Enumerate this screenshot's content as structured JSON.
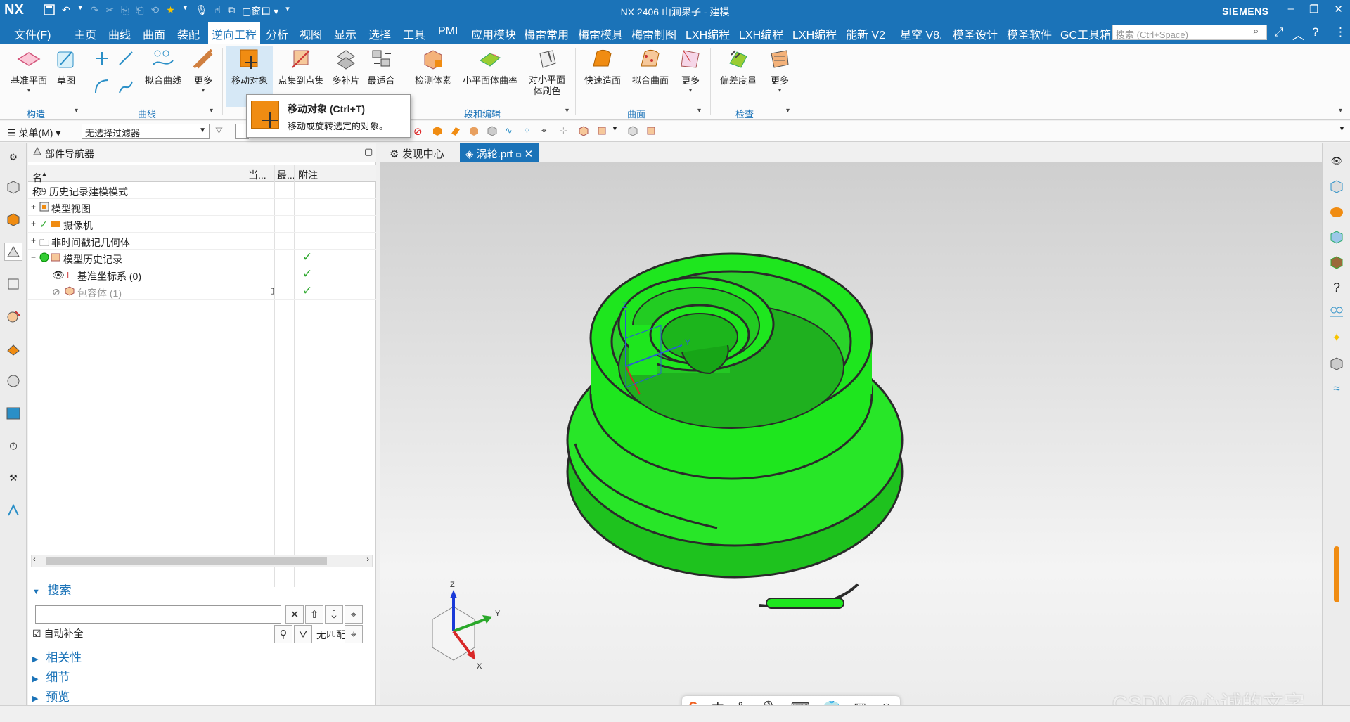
{
  "titlebar": {
    "logo": "NX",
    "title": "NX 2406 山涧果子 - 建模",
    "brand": "SIEMENS",
    "window_menu": "窗口",
    "qa_icons": [
      "save-icon",
      "undo-icon",
      "redo-icon",
      "star-icon",
      "mic-icon"
    ]
  },
  "menubar": {
    "file": "文件(F)",
    "tabs": [
      "主页",
      "曲线",
      "曲面",
      "装配",
      "逆向工程",
      "分析",
      "视图",
      "显示",
      "选择",
      "工具",
      "PMI",
      "应用模块",
      "梅雷常用",
      "梅雷模具",
      "梅雷制图",
      "LXH编程",
      "LXH编程",
      "LXH编程",
      "能新 V2",
      "星空 V8.",
      "模圣设计",
      "模圣软件",
      "GC工具箱"
    ],
    "active_tab": "逆向工程",
    "search_placeholder": "搜索 (Ctrl+Space)"
  },
  "ribbon": {
    "buttons": {
      "datum_plane": "基准平面",
      "sketch": "草图",
      "fit_curve": "拟合曲线",
      "more1": "更多",
      "move_object": "移动对象",
      "points_to_pointset": "点集到点集",
      "multi_patch": "多补片",
      "best_fit": "最适合",
      "check_body": "检测体素",
      "small_plane_curvature": "小平面体曲率",
      "small_plane_brush": "对小平面体刷色",
      "quick_surface": "快速造面",
      "fit_surface": "拟合曲面",
      "more2": "更多",
      "deviation_measure": "偏差度量",
      "more3": "更多"
    },
    "groups": {
      "construct": "构造",
      "curve": "曲线",
      "segment_edit": "段和编辑",
      "surface": "曲面",
      "check": "检查"
    }
  },
  "tooltip": {
    "title": "移动对象 (Ctrl+T)",
    "desc": "移动或旋转选定的对象。"
  },
  "selbar": {
    "menu": "菜单(M)",
    "filter": "无选择过滤器"
  },
  "navigator": {
    "title": "部件导航器",
    "columns": {
      "name": "名称",
      "current": "当...",
      "latest": "最...",
      "note": "附注"
    },
    "rows": [
      {
        "label": "历史记录建模模式",
        "expander": "",
        "latest": false
      },
      {
        "label": "模型视图",
        "expander": "+",
        "latest": false
      },
      {
        "label": "摄像机",
        "expander": "+",
        "latest": false
      },
      {
        "label": "非时间戳记几何体",
        "expander": "+",
        "latest": false
      },
      {
        "label": "模型历史记录",
        "expander": "−",
        "latest": true
      },
      {
        "label": "基准坐标系 (0)",
        "expander": "",
        "latest": true
      },
      {
        "label": "包容体 (1)",
        "expander": "",
        "latest": true
      }
    ],
    "check_mark": "✓"
  },
  "search_panel": {
    "title": "搜索",
    "autocomplete_label": "自动补全",
    "no_match": "无匹配",
    "sections": [
      "相关性",
      "细节",
      "预览"
    ]
  },
  "graphics_tabs": {
    "discovery": "发现中心",
    "part": "涡轮.prt"
  },
  "triad": {
    "x": "X",
    "y": "Y",
    "z": "Z"
  },
  "ime": {
    "chinese": "中"
  },
  "watermark": "CSDN @心诚的文字",
  "colors": {
    "nx_blue": "#1b73b8",
    "part_green": "#1ee61e",
    "tooltip_orange": "#f08c12"
  }
}
